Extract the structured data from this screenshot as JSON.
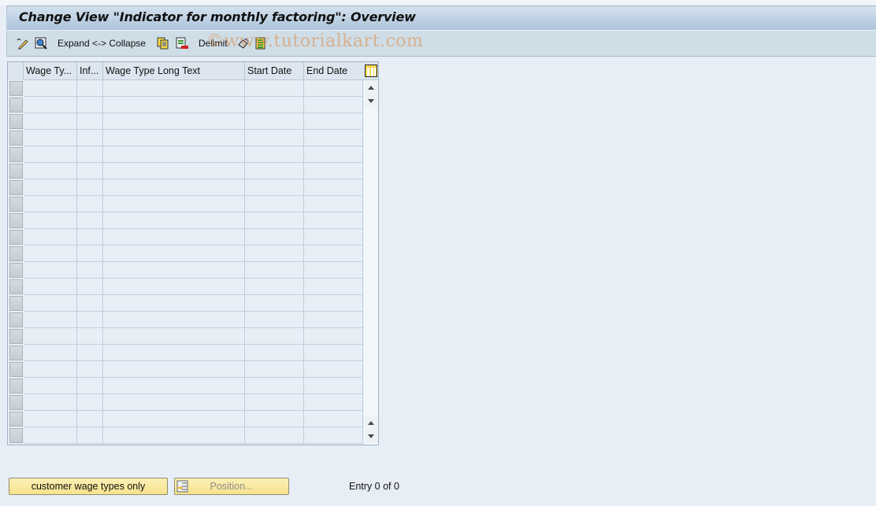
{
  "window": {
    "title": "Change View \"Indicator for monthly factoring\": Overview"
  },
  "toolbar": {
    "items": [
      {
        "type": "icon",
        "icon": "display-change-icon"
      },
      {
        "type": "icon",
        "icon": "find-icon"
      },
      {
        "type": "button",
        "label": "Expand <-> Collapse"
      },
      {
        "type": "icon",
        "icon": "copy-as-icon"
      },
      {
        "type": "icon",
        "icon": "delete-icon"
      },
      {
        "type": "button",
        "label": "Delimit"
      },
      {
        "type": "icon",
        "icon": "undo-change-icon"
      },
      {
        "type": "icon",
        "icon": "select-all-icon"
      }
    ],
    "expand_collapse_label": "Expand <-> Collapse",
    "delimit_label": "Delimit"
  },
  "watermark": "©www.tutorialkart.com",
  "table": {
    "columns": [
      {
        "label": "Wage Ty..."
      },
      {
        "label": "Inf..."
      },
      {
        "label": "Wage Type Long Text"
      },
      {
        "label": "Start Date"
      },
      {
        "label": "End Date"
      }
    ],
    "row_count": 22,
    "rows": []
  },
  "footer": {
    "customer_button_label": "customer wage types only",
    "position_button_label": "Position...",
    "entry_text": "Entry 0 of 0"
  }
}
